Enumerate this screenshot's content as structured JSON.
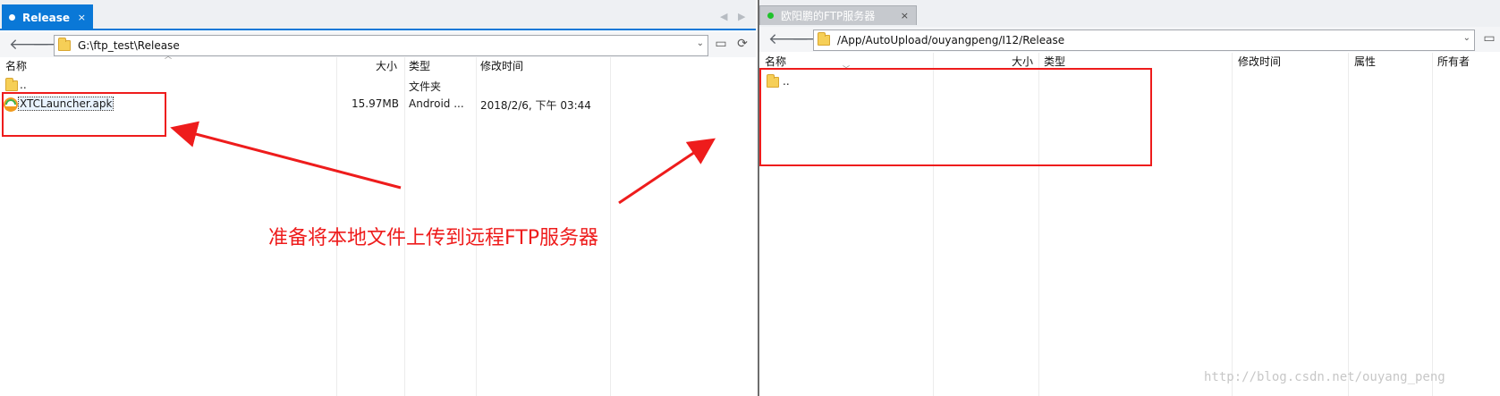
{
  "left": {
    "tab": {
      "label": "Release",
      "close": "×"
    },
    "tab_scroll": {
      "prev": "◀",
      "next": "▶"
    },
    "nav": {
      "back": "🡐",
      "forward": "🡒"
    },
    "address": "G:\\ftp_test\\Release",
    "address_drop": "⌄",
    "tools": {
      "new_folder": "▭",
      "refresh": "⟳"
    },
    "columns": {
      "name": "名称",
      "size": "大小",
      "type": "类型",
      "modified": "修改时间"
    },
    "rows": [
      {
        "name": "..",
        "size": "",
        "type": "文件夹",
        "modified": ""
      },
      {
        "name": "XTCLauncher.apk",
        "size": "15.97MB",
        "type": "Android ...",
        "modified": "2018/2/6, 下午 03:44"
      }
    ]
  },
  "right": {
    "tab": {
      "label": "欧阳鹏的FTP服务器",
      "close": "×"
    },
    "nav": {
      "back": "🡐",
      "forward": "🡒"
    },
    "address": "/App/AutoUpload/ouyangpeng/I12/Release",
    "address_drop": "⌄",
    "tools": {
      "new_folder": "▭"
    },
    "columns": {
      "name": "名称",
      "size": "大小",
      "type": "类型",
      "modified": "修改时间",
      "attributes": "属性",
      "owner": "所有者"
    },
    "rows": [
      {
        "name": ".."
      }
    ]
  },
  "annotation": {
    "text": "准备将本地文件上传到远程FTP服务器",
    "color": "#ee1c1c"
  },
  "watermark": "http://blog.csdn.net/ouyang_peng",
  "colors": {
    "accent": "#0a78d7",
    "connected": "#1ec22a",
    "folder": "#f6cf57"
  }
}
